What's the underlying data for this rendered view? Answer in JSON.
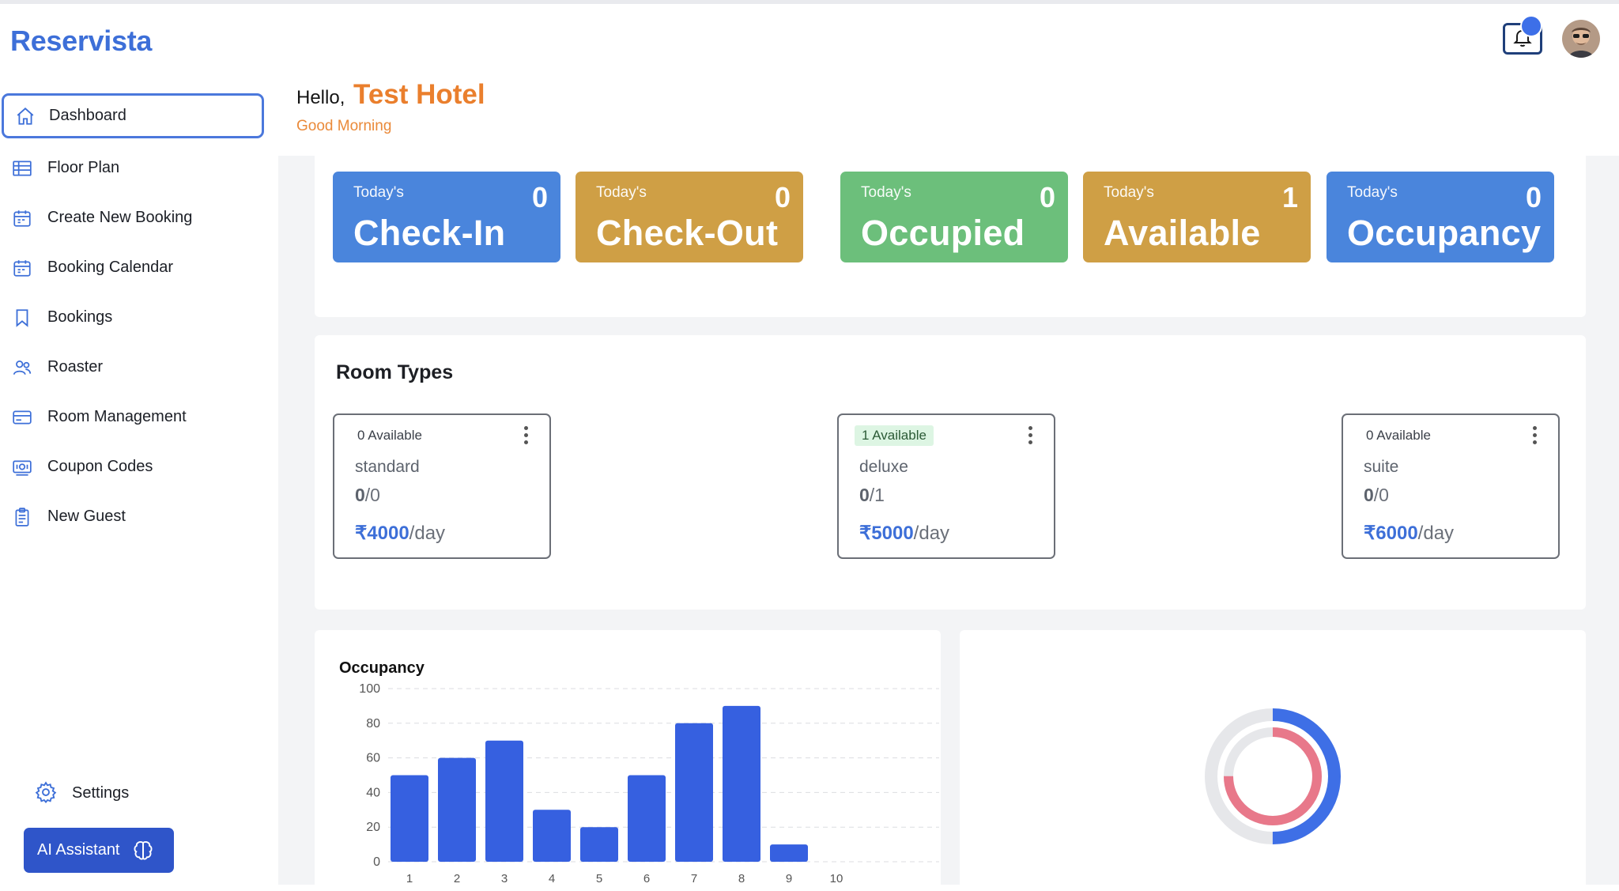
{
  "app": {
    "brand": "Reservista"
  },
  "sidebar": {
    "items": [
      {
        "label": "Dashboard",
        "icon": "home-icon",
        "active": true
      },
      {
        "label": "Floor Plan",
        "icon": "table-icon"
      },
      {
        "label": "Create New Booking",
        "icon": "calendar-icon"
      },
      {
        "label": "Booking Calendar",
        "icon": "calendar-icon"
      },
      {
        "label": "Bookings",
        "icon": "bookmark-icon"
      },
      {
        "label": "Roaster",
        "icon": "users-icon"
      },
      {
        "label": "Room Management",
        "icon": "card-icon"
      },
      {
        "label": "Coupon Codes",
        "icon": "coupon-icon"
      },
      {
        "label": "New Guest",
        "icon": "clipboard-icon"
      }
    ],
    "settings_label": "Settings",
    "ai_label": "AI Assistant"
  },
  "header": {
    "hello": "Hello,",
    "hotel": "Test Hotel",
    "greeting": "Good Morning"
  },
  "stats": [
    {
      "small": "Today's",
      "title": "Check-In",
      "count": "0",
      "color": "#4a85dc"
    },
    {
      "small": "Today's",
      "title": "Check-Out",
      "count": "0",
      "color": "#cf9f45"
    },
    {
      "small": "Today's",
      "title": "Occupied",
      "count": "0",
      "color": "#6cbf7b"
    },
    {
      "small": "Today's",
      "title": "Available",
      "count": "1",
      "color": "#cf9f45"
    },
    {
      "small": "Today's",
      "title": "Occupancy",
      "count": "0",
      "color": "#4a85dc"
    }
  ],
  "room_types": {
    "title": "Room Types",
    "rooms": [
      {
        "available": "0 Available",
        "name": "standard",
        "occupied": "0",
        "total": "/0",
        "price": "₹4000",
        "unit": "/day"
      },
      {
        "available": "1 Available",
        "name": "deluxe",
        "occupied": "0",
        "total": "/1",
        "price": "₹5000",
        "unit": "/day"
      },
      {
        "available": "0 Available",
        "name": "suite",
        "occupied": "0",
        "total": "/0",
        "price": "₹6000",
        "unit": "/day"
      }
    ]
  },
  "chart_data": [
    {
      "type": "bar",
      "title": "Occupancy",
      "categories": [
        "1",
        "2",
        "3",
        "4",
        "5",
        "6",
        "7",
        "8",
        "9",
        "10"
      ],
      "values": [
        50,
        60,
        70,
        30,
        20,
        50,
        80,
        90,
        10,
        0
      ],
      "ylim": [
        0,
        100
      ],
      "yticks": [
        0,
        20,
        40,
        60,
        80,
        100
      ],
      "grid": true,
      "color": "#3660e0"
    },
    {
      "type": "pie",
      "rings": [
        {
          "value": 0.5,
          "color": "#3e6fe6",
          "track": "#e6e7ea"
        },
        {
          "value": 0.75,
          "color": "#e8788a",
          "track": "#e6e7ea"
        }
      ]
    }
  ]
}
